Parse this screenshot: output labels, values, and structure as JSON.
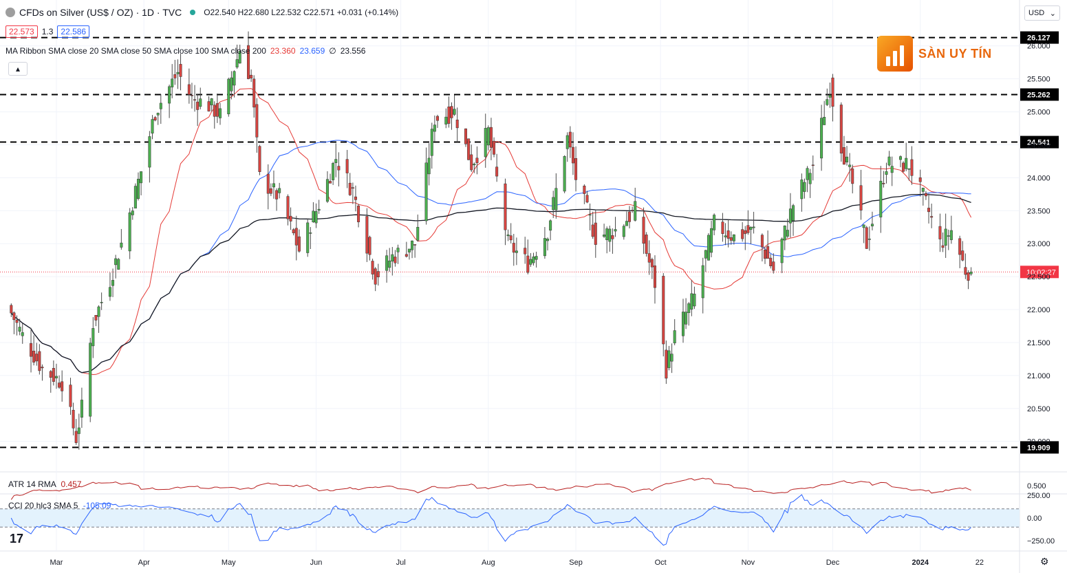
{
  "header": {
    "symbol_title": "CFDs on Silver (US$ / OZ) · 1D · TVC",
    "ohlc_text": "O22.540  H22.680  L22.532  C22.571  +0.031 (+0.14%)",
    "bid": "22.573",
    "spread": "1.3",
    "ask": "22.586",
    "ribbon_label": "MA Ribbon SMA close 20 SMA close 50 SMA close 100 SMA close 200",
    "ribbon_v20": "23.360",
    "ribbon_v50": "23.659",
    "ribbon_v100": "∅",
    "ribbon_v200": "23.556",
    "collapse_icon": "▴",
    "currency": "USD",
    "currency_caret": "⌄"
  },
  "watermark": {
    "text": "SÀN UY TÍN",
    "icon": "bar-chart-logo"
  },
  "tv_logo": "17",
  "settings_icon": "⚙",
  "colors": {
    "up": "#26a69a",
    "up_body": "#4caf50",
    "down": "#d64541",
    "sma20": "#e53935",
    "sma50": "#2962ff",
    "sma200": "#131722",
    "atr": "#b71c1c",
    "cci": "#2962ff",
    "cci_band": "#e3f2fd"
  },
  "price_axis": {
    "ticks": [
      "26.000",
      "25.500",
      "25.000",
      "24.500",
      "24.000",
      "23.500",
      "23.000",
      "22.500",
      "22.000",
      "21.500",
      "21.000",
      "20.500",
      "20.000"
    ],
    "levels": [
      {
        "label": "26.127",
        "value": 26.127
      },
      {
        "label": "25.262",
        "value": 25.262
      },
      {
        "label": "24.541",
        "value": 24.541
      },
      {
        "label": "19.909",
        "value": 19.909
      }
    ],
    "countdown_label": "10:02:27",
    "countdown_value": 22.571
  },
  "atr": {
    "label": "ATR 14 RMA",
    "value": "0.457",
    "axis_tick": "0.500"
  },
  "cci": {
    "label": "CCI 20 hlc3 SMA 5",
    "value": "-105.09",
    "axis_ticks": [
      "250.00",
      "0.00",
      "−250.00"
    ]
  },
  "time_axis": [
    "Mar",
    "Apr",
    "May",
    "Jun",
    "Jul",
    "Aug",
    "Sep",
    "Oct",
    "Nov",
    "Dec",
    "2024",
    "22"
  ],
  "chart_data": {
    "type": "candlestick",
    "title": "CFDs on Silver (US$ / OZ) · 1D · TVC",
    "ylim": [
      19.6,
      26.3
    ],
    "x_ticks": [
      "Mar",
      "Apr",
      "May",
      "Jun",
      "Jul",
      "Aug",
      "Sep",
      "Oct",
      "Nov",
      "Dec",
      "2024",
      "22"
    ],
    "series": [
      {
        "name": "SMA 20",
        "last": 23.36
      },
      {
        "name": "SMA 50",
        "last": 23.659
      },
      {
        "name": "SMA 200",
        "last": 23.556
      }
    ],
    "close_path": [
      {
        "date": "2023-02-13",
        "close": 21.95
      },
      {
        "date": "2023-02-17",
        "close": 21.6
      },
      {
        "date": "2023-02-24",
        "close": 21.1
      },
      {
        "date": "2023-03-03",
        "close": 20.9
      },
      {
        "date": "2023-03-08",
        "close": 20.05
      },
      {
        "date": "2023-03-10",
        "close": 20.5
      },
      {
        "date": "2023-03-14",
        "close": 21.8
      },
      {
        "date": "2023-03-20",
        "close": 22.45
      },
      {
        "date": "2023-03-24",
        "close": 23.0
      },
      {
        "date": "2023-03-31",
        "close": 24.1
      },
      {
        "date": "2023-04-05",
        "close": 25.0
      },
      {
        "date": "2023-04-13",
        "close": 25.6
      },
      {
        "date": "2023-04-18",
        "close": 25.2
      },
      {
        "date": "2023-04-24",
        "close": 25.1
      },
      {
        "date": "2023-04-28",
        "close": 24.95
      },
      {
        "date": "2023-05-05",
        "close": 25.95
      },
      {
        "date": "2023-05-09",
        "close": 25.5
      },
      {
        "date": "2023-05-12",
        "close": 24.0
      },
      {
        "date": "2023-05-19",
        "close": 23.7
      },
      {
        "date": "2023-05-26",
        "close": 22.9
      },
      {
        "date": "2023-06-02",
        "close": 23.6
      },
      {
        "date": "2023-06-08",
        "close": 24.3
      },
      {
        "date": "2023-06-14",
        "close": 23.8
      },
      {
        "date": "2023-06-22",
        "close": 22.5
      },
      {
        "date": "2023-06-28",
        "close": 22.8
      },
      {
        "date": "2023-07-06",
        "close": 23.0
      },
      {
        "date": "2023-07-13",
        "close": 24.9
      },
      {
        "date": "2023-07-20",
        "close": 25.0
      },
      {
        "date": "2023-07-26",
        "close": 24.2
      },
      {
        "date": "2023-08-01",
        "close": 24.7
      },
      {
        "date": "2023-08-08",
        "close": 23.0
      },
      {
        "date": "2023-08-15",
        "close": 22.7
      },
      {
        "date": "2023-08-22",
        "close": 23.2
      },
      {
        "date": "2023-08-29",
        "close": 24.6
      },
      {
        "date": "2023-09-01",
        "close": 24.0
      },
      {
        "date": "2023-09-08",
        "close": 23.1
      },
      {
        "date": "2023-09-15",
        "close": 23.2
      },
      {
        "date": "2023-09-22",
        "close": 23.5
      },
      {
        "date": "2023-09-29",
        "close": 22.4
      },
      {
        "date": "2023-10-03",
        "close": 21.1
      },
      {
        "date": "2023-10-06",
        "close": 21.6
      },
      {
        "date": "2023-10-13",
        "close": 22.2
      },
      {
        "date": "2023-10-20",
        "close": 23.3
      },
      {
        "date": "2023-10-27",
        "close": 23.1
      },
      {
        "date": "2023-11-03",
        "close": 23.2
      },
      {
        "date": "2023-11-10",
        "close": 22.6
      },
      {
        "date": "2023-11-17",
        "close": 23.6
      },
      {
        "date": "2023-11-24",
        "close": 24.2
      },
      {
        "date": "2023-11-30",
        "close": 25.4
      },
      {
        "date": "2023-12-04",
        "close": 24.5
      },
      {
        "date": "2023-12-08",
        "close": 23.9
      },
      {
        "date": "2023-12-13",
        "close": 23.0
      },
      {
        "date": "2023-12-20",
        "close": 24.2
      },
      {
        "date": "2023-12-28",
        "close": 24.2
      },
      {
        "date": "2024-01-03",
        "close": 23.6
      },
      {
        "date": "2024-01-08",
        "close": 23.0
      },
      {
        "date": "2024-01-12",
        "close": 23.2
      },
      {
        "date": "2024-01-17",
        "close": 22.6
      },
      {
        "date": "2024-01-19",
        "close": 22.571
      }
    ]
  }
}
